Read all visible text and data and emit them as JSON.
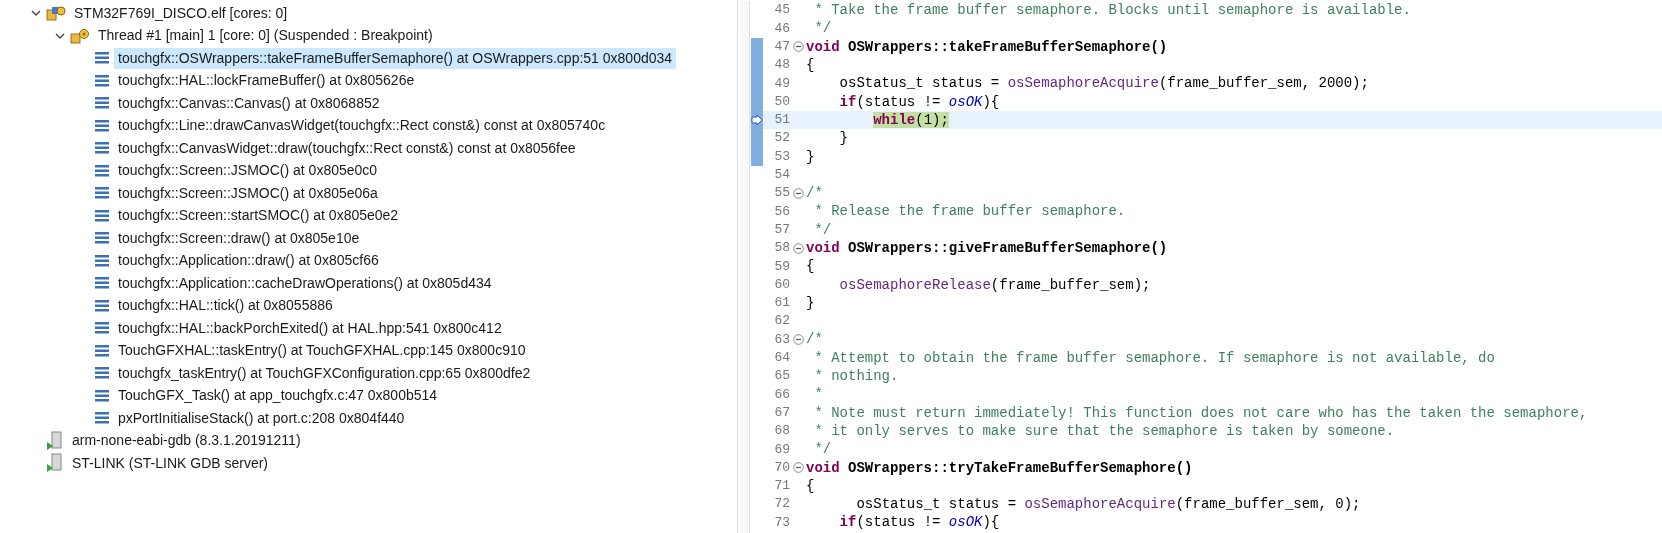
{
  "debug_tree": [
    {
      "label": "STM32F769I_DISCO.elf [cores: 0]",
      "kind": "app",
      "expanded": true,
      "selected": false,
      "children": [
        {
          "label": "Thread #1 [main] 1 [core: 0] (Suspended : Breakpoint)",
          "kind": "thread",
          "expanded": true,
          "selected": false,
          "children": [
            {
              "label": "touchgfx::OSWrappers::takeFrameBufferSemaphore() at OSWrappers.cpp:51 0x800d034",
              "kind": "frame",
              "selected": true
            },
            {
              "label": "touchgfx::HAL::lockFrameBuffer() at 0x805626e",
              "kind": "frame",
              "selected": false
            },
            {
              "label": "touchgfx::Canvas::Canvas() at 0x8068852",
              "kind": "frame",
              "selected": false
            },
            {
              "label": "touchgfx::Line::drawCanvasWidget(touchgfx::Rect const&) const at 0x805740c",
              "kind": "frame",
              "selected": false
            },
            {
              "label": "touchgfx::CanvasWidget::draw(touchgfx::Rect const&) const at 0x8056fee",
              "kind": "frame",
              "selected": false
            },
            {
              "label": "touchgfx::Screen::JSMOC() at 0x805e0c0",
              "kind": "frame",
              "selected": false
            },
            {
              "label": "touchgfx::Screen::JSMOC() at 0x805e06a",
              "kind": "frame",
              "selected": false
            },
            {
              "label": "touchgfx::Screen::startSMOC() at 0x805e0e2",
              "kind": "frame",
              "selected": false
            },
            {
              "label": "touchgfx::Screen::draw() at 0x805e10e",
              "kind": "frame",
              "selected": false
            },
            {
              "label": "touchgfx::Application::draw() at 0x805cf66",
              "kind": "frame",
              "selected": false
            },
            {
              "label": "touchgfx::Application::cacheDrawOperations() at 0x805d434",
              "kind": "frame",
              "selected": false
            },
            {
              "label": "touchgfx::HAL::tick() at 0x8055886",
              "kind": "frame",
              "selected": false
            },
            {
              "label": "touchgfx::HAL::backPorchExited() at HAL.hpp:541 0x800c412",
              "kind": "frame",
              "selected": false
            },
            {
              "label": "TouchGFXHAL::taskEntry() at TouchGFXHAL.cpp:145 0x800c910",
              "kind": "frame",
              "selected": false
            },
            {
              "label": "touchgfx_taskEntry() at TouchGFXConfiguration.cpp:65 0x800dfe2",
              "kind": "frame",
              "selected": false
            },
            {
              "label": "TouchGFX_Task() at app_touchgfx.c:47 0x800b514",
              "kind": "frame",
              "selected": false
            },
            {
              "label": "pxPortInitialiseStack() at port.c:208 0x804f440",
              "kind": "frame",
              "selected": false
            }
          ]
        }
      ]
    },
    {
      "label": "arm-none-eabi-gdb (8.3.1.20191211)",
      "kind": "process",
      "selected": false
    },
    {
      "label": "ST-LINK (ST-LINK GDB server)",
      "kind": "process",
      "selected": false
    }
  ],
  "editor": {
    "lines": [
      {
        "number": "45",
        "fold": false,
        "in_range": false,
        "current": false,
        "tokens": [
          {
            "text": " * Take the frame buffer semaphore. Blocks until semaphore is available.",
            "kind": "comment"
          }
        ]
      },
      {
        "number": "46",
        "fold": false,
        "in_range": false,
        "current": false,
        "tokens": [
          {
            "text": " */",
            "kind": "comment"
          }
        ]
      },
      {
        "number": "47",
        "fold": true,
        "in_range": true,
        "current": false,
        "tokens": [
          {
            "text": "void",
            "kind": "keyword"
          },
          {
            "text": " OSWrappers::takeFrameBufferSemaphore()",
            "kind": "bold"
          }
        ]
      },
      {
        "number": "48",
        "fold": false,
        "in_range": true,
        "current": false,
        "tokens": [
          {
            "text": "{",
            "kind": "plain"
          }
        ]
      },
      {
        "number": "49",
        "fold": false,
        "in_range": true,
        "current": false,
        "tokens": [
          {
            "text": "    osStatus_t status = ",
            "kind": "plain"
          },
          {
            "text": "osSemaphoreAcquire",
            "kind": "function"
          },
          {
            "text": "(frame_buffer_sem, 2000);",
            "kind": "plain"
          }
        ]
      },
      {
        "number": "50",
        "fold": false,
        "in_range": true,
        "current": false,
        "tokens": [
          {
            "text": "    if",
            "kind": "keyword"
          },
          {
            "text": "(status != ",
            "kind": "plain"
          },
          {
            "text": "osOK",
            "kind": "constant"
          },
          {
            "text": "){",
            "kind": "plain"
          }
        ]
      },
      {
        "number": "51",
        "fold": false,
        "in_range": true,
        "current": true,
        "tokens": [
          {
            "text": "        while",
            "kind": "keyword"
          },
          {
            "text": "(1);",
            "kind": "plain"
          }
        ]
      },
      {
        "number": "52",
        "fold": false,
        "in_range": true,
        "current": false,
        "tokens": [
          {
            "text": "    }",
            "kind": "plain"
          }
        ]
      },
      {
        "number": "53",
        "fold": false,
        "in_range": true,
        "current": false,
        "tokens": [
          {
            "text": "}",
            "kind": "plain"
          }
        ]
      },
      {
        "number": "54",
        "fold": false,
        "in_range": false,
        "current": false
      },
      {
        "number": "55",
        "fold": true,
        "in_range": false,
        "current": false,
        "tokens": [
          {
            "text": "/*",
            "kind": "comment"
          }
        ]
      },
      {
        "number": "56",
        "fold": false,
        "in_range": false,
        "current": false,
        "tokens": [
          {
            "text": " * Release the frame buffer semaphore.",
            "kind": "comment"
          }
        ]
      },
      {
        "number": "57",
        "fold": false,
        "in_range": false,
        "current": false,
        "tokens": [
          {
            "text": " */",
            "kind": "comment"
          }
        ]
      },
      {
        "number": "58",
        "fold": true,
        "in_range": false,
        "current": false,
        "tokens": [
          {
            "text": "void",
            "kind": "keyword"
          },
          {
            "text": " OSWrappers::giveFrameBufferSemaphore()",
            "kind": "bold"
          }
        ]
      },
      {
        "number": "59",
        "fold": false,
        "in_range": false,
        "current": false,
        "tokens": [
          {
            "text": "{",
            "kind": "plain"
          }
        ]
      },
      {
        "number": "60",
        "fold": false,
        "in_range": false,
        "current": false,
        "tokens": [
          {
            "text": "    osSemaphoreRelease",
            "kind": "function"
          },
          {
            "text": "(frame_buffer_sem);",
            "kind": "plain"
          }
        ]
      },
      {
        "number": "61",
        "fold": false,
        "in_range": false,
        "current": false,
        "tokens": [
          {
            "text": "}",
            "kind": "plain"
          }
        ]
      },
      {
        "number": "62",
        "fold": false,
        "in_range": false,
        "current": false
      },
      {
        "number": "63",
        "fold": true,
        "in_range": false,
        "current": false,
        "tokens": [
          {
            "text": "/*",
            "kind": "comment"
          }
        ]
      },
      {
        "number": "64",
        "fold": false,
        "in_range": false,
        "current": false,
        "tokens": [
          {
            "text": " * Attempt to obtain the frame buffer semaphore. If semaphore is not available, do",
            "kind": "comment"
          }
        ]
      },
      {
        "number": "65",
        "fold": false,
        "in_range": false,
        "current": false,
        "tokens": [
          {
            "text": " * nothing.",
            "kind": "comment"
          }
        ]
      },
      {
        "number": "66",
        "fold": false,
        "in_range": false,
        "current": false,
        "tokens": [
          {
            "text": " *",
            "kind": "comment"
          }
        ]
      },
      {
        "number": "67",
        "fold": false,
        "in_range": false,
        "current": false,
        "tokens": [
          {
            "text": " * Note must return immediately! This function does not care who has the taken the semaphore,",
            "kind": "comment"
          }
        ]
      },
      {
        "number": "68",
        "fold": false,
        "in_range": false,
        "current": false,
        "tokens": [
          {
            "text": " * it only serves to make sure that the semaphore is taken by someone.",
            "kind": "comment"
          }
        ]
      },
      {
        "number": "69",
        "fold": false,
        "in_range": false,
        "current": false,
        "tokens": [
          {
            "text": " */",
            "kind": "comment"
          }
        ]
      },
      {
        "number": "70",
        "fold": true,
        "in_range": false,
        "current": false,
        "tokens": [
          {
            "text": "void",
            "kind": "keyword"
          },
          {
            "text": " OSWrappers::tryTakeFrameBufferSemaphore()",
            "kind": "bold"
          }
        ]
      },
      {
        "number": "71",
        "fold": false,
        "in_range": false,
        "current": false,
        "tokens": [
          {
            "text": "{",
            "kind": "plain"
          }
        ]
      },
      {
        "number": "72",
        "fold": false,
        "in_range": false,
        "current": false,
        "tokens": [
          {
            "text": "      osStatus_t status = ",
            "kind": "plain"
          },
          {
            "text": "osSemaphoreAcquire",
            "kind": "function"
          },
          {
            "text": "(frame_buffer_sem, 0);",
            "kind": "plain"
          }
        ]
      },
      {
        "number": "73",
        "fold": false,
        "in_range": false,
        "current": false,
        "tokens": [
          {
            "text": "    if",
            "kind": "keyword"
          },
          {
            "text": "(status != ",
            "kind": "plain"
          },
          {
            "text": "osOK",
            "kind": "constant"
          },
          {
            "text": "){",
            "kind": "plain"
          }
        ]
      }
    ]
  }
}
